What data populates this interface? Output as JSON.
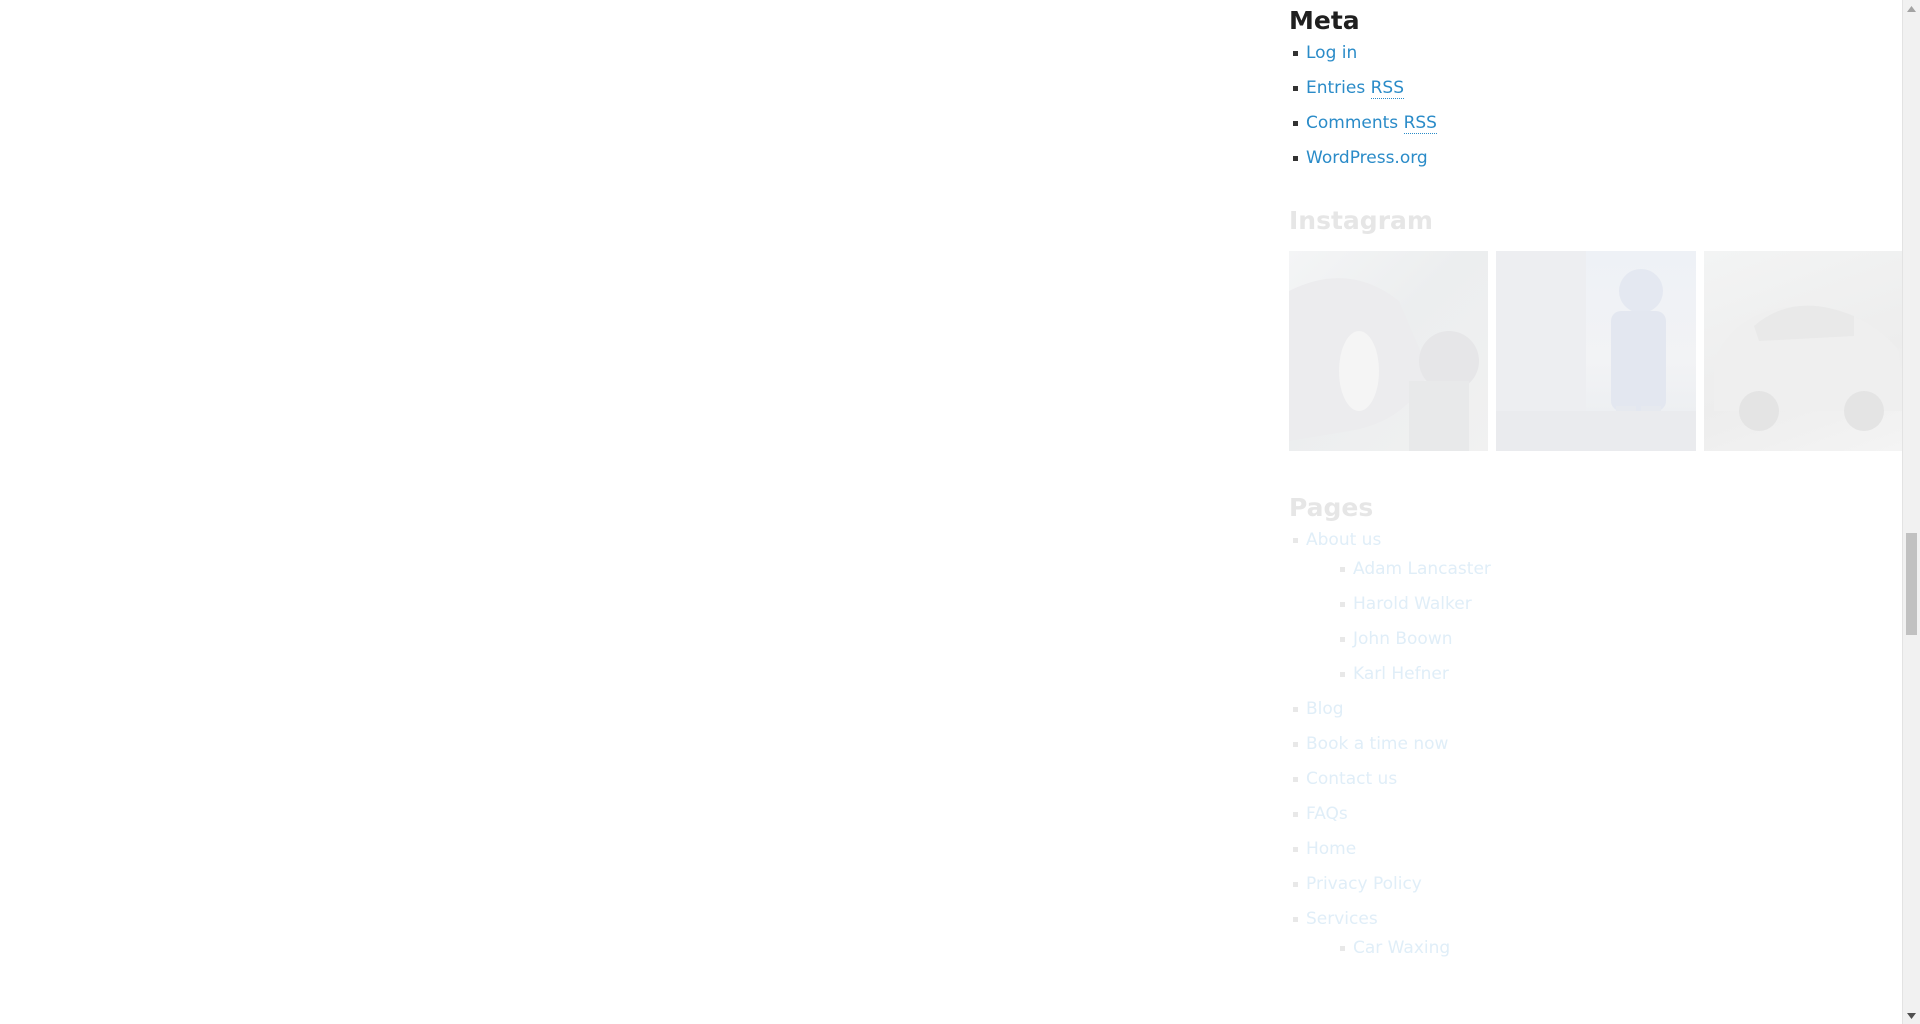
{
  "meta": {
    "title": "Meta",
    "items": [
      {
        "label": "Log in"
      },
      {
        "label": "Entries",
        "abbr": "RSS"
      },
      {
        "label": "Comments",
        "abbr": "RSS"
      },
      {
        "label": "WordPress.org"
      }
    ]
  },
  "instagram": {
    "title": "Instagram",
    "images": [
      "instagram-image-car-wash-1",
      "instagram-image-car-wash-2",
      "instagram-image-foamed-car"
    ]
  },
  "pages": {
    "title": "Pages",
    "about": "About us",
    "about_children": [
      "Adam Lancaster",
      "Harold Walker",
      "John Boown",
      "Karl Hefner"
    ],
    "items": [
      "Blog",
      "Book a time now",
      "Contact us",
      "FAQs",
      "Home",
      "Privacy Policy"
    ],
    "services": "Services",
    "services_children": [
      "Car Waxing"
    ]
  },
  "colors": {
    "link": "#2a8bc8",
    "heading": "#1f1f1f",
    "faded_heading": "#e6e6e6",
    "faded_link": "#e0eef8"
  },
  "icons": {
    "scroll_up": "triangle-up-icon",
    "scroll_down": "triangle-down-icon"
  }
}
